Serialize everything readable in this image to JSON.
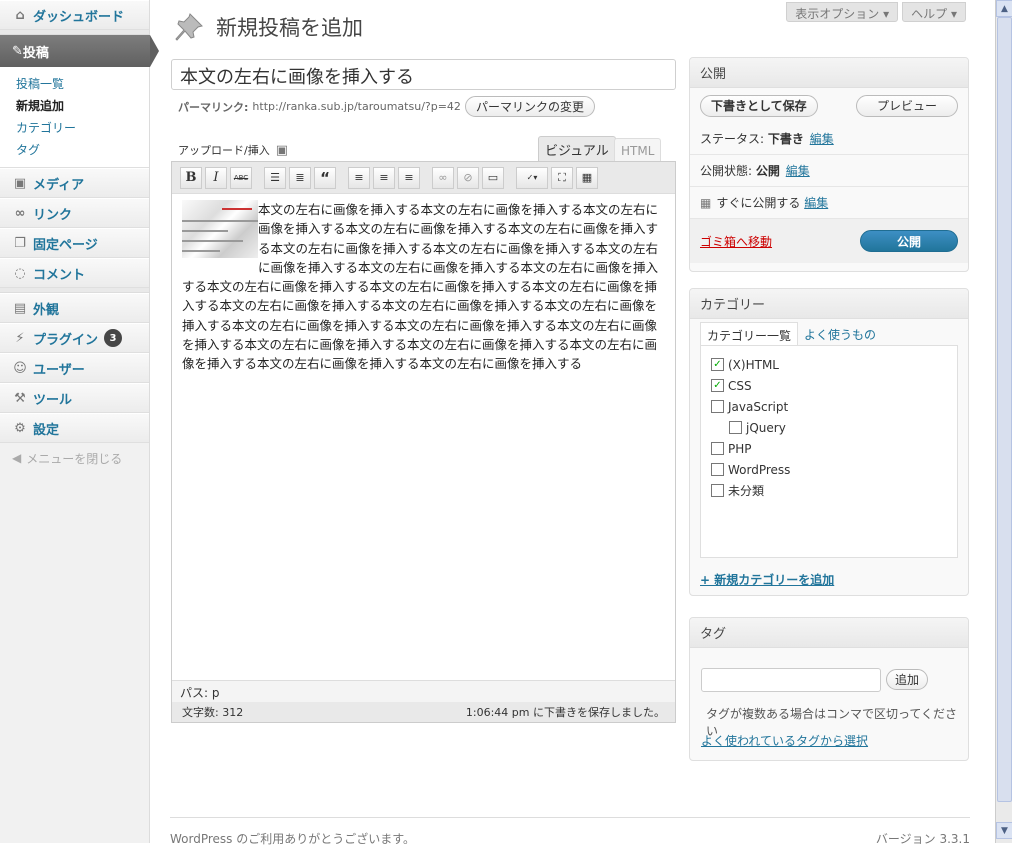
{
  "sidebar": {
    "dashboard": "ダッシュボード",
    "posts": "投稿",
    "posts_sub": [
      "投稿一覧",
      "新規追加",
      "カテゴリー",
      "タグ"
    ],
    "media": "メディア",
    "links": "リンク",
    "pages": "固定ページ",
    "comments": "コメント",
    "appearance": "外観",
    "plugins": "プラグイン",
    "plugins_badge": "3",
    "users": "ユーザー",
    "tools": "ツール",
    "settings": "設定",
    "collapse": "メニューを閉じる"
  },
  "top": {
    "screen_options": "表示オプション",
    "help": "ヘルプ"
  },
  "page_title": "新規投稿を追加",
  "post": {
    "title": "本文の左右に画像を挿入する",
    "permalink_label": "パーマリンク:",
    "permalink_url": "http://ranka.sub.jp/taroumatsu/?p=42",
    "permalink_button": "パーマリンクの変更",
    "upload_label": "アップロード/挿入",
    "tab_visual": "ビジュアル",
    "tab_html": "HTML",
    "body": "本文の左右に画像を挿入する本文の左右に画像を挿入する本文の左右に画像を挿入する本文の左右に画像を挿入する本文の左右に画像を挿入する本文の左右に画像を挿入する本文の左右に画像を挿入する本文の左右に画像を挿入する本文の左右に画像を挿入する本文の左右に画像を挿入する本文の左右に画像を挿入する本文の左右に画像を挿入する本文の左右に画像を挿入する本文の左右に画像を挿入する本文の左右に画像を挿入する本文の左右に画像を挿入する本文の左右に画像を挿入する本文の左右に画像を挿入する本文の左右に画像を挿入する本文の左右に画像を挿入する本文の左右に画像を挿入する本文の左右に画像を挿入する本文の左右に画像を挿入する本文の左右に画像を挿入する",
    "path": "パス: p",
    "word_count": "文字数: 312",
    "saved_msg": "1:06:44 pm に下書きを保存しました。"
  },
  "toolbar": {
    "bold": "B",
    "italic": "I",
    "strike": "ABC",
    "quote": "“"
  },
  "publish": {
    "title": "公開",
    "save_draft": "下書きとして保存",
    "preview": "プレビュー",
    "status_label": "ステータス:",
    "status_value": "下書き",
    "visibility_label": "公開状態:",
    "visibility_value": "公開",
    "schedule_label": "すぐに公開する",
    "edit": "編集",
    "trash": "ゴミ箱へ移動",
    "publish_button": "公開"
  },
  "categories": {
    "title": "カテゴリー",
    "tab_all": "カテゴリー一覧",
    "tab_popular": "よく使うもの",
    "items": [
      {
        "label": "(X)HTML",
        "checked": "✓"
      },
      {
        "label": "CSS",
        "checked": "✓"
      },
      {
        "label": "JavaScript",
        "checked": ""
      },
      {
        "label": "jQuery",
        "checked": ""
      },
      {
        "label": "PHP",
        "checked": ""
      },
      {
        "label": "WordPress",
        "checked": ""
      },
      {
        "label": "未分類",
        "checked": ""
      }
    ],
    "add_new": "+ 新規カテゴリーを追加"
  },
  "tags": {
    "title": "タグ",
    "add_button": "追加",
    "hint": "タグが複数ある場合はコンマで区切ってください",
    "choose": "よく使われているタグから選択"
  },
  "footer": {
    "left": "WordPress のご利用ありがとうございます。",
    "right": "バージョン 3.3.1"
  }
}
